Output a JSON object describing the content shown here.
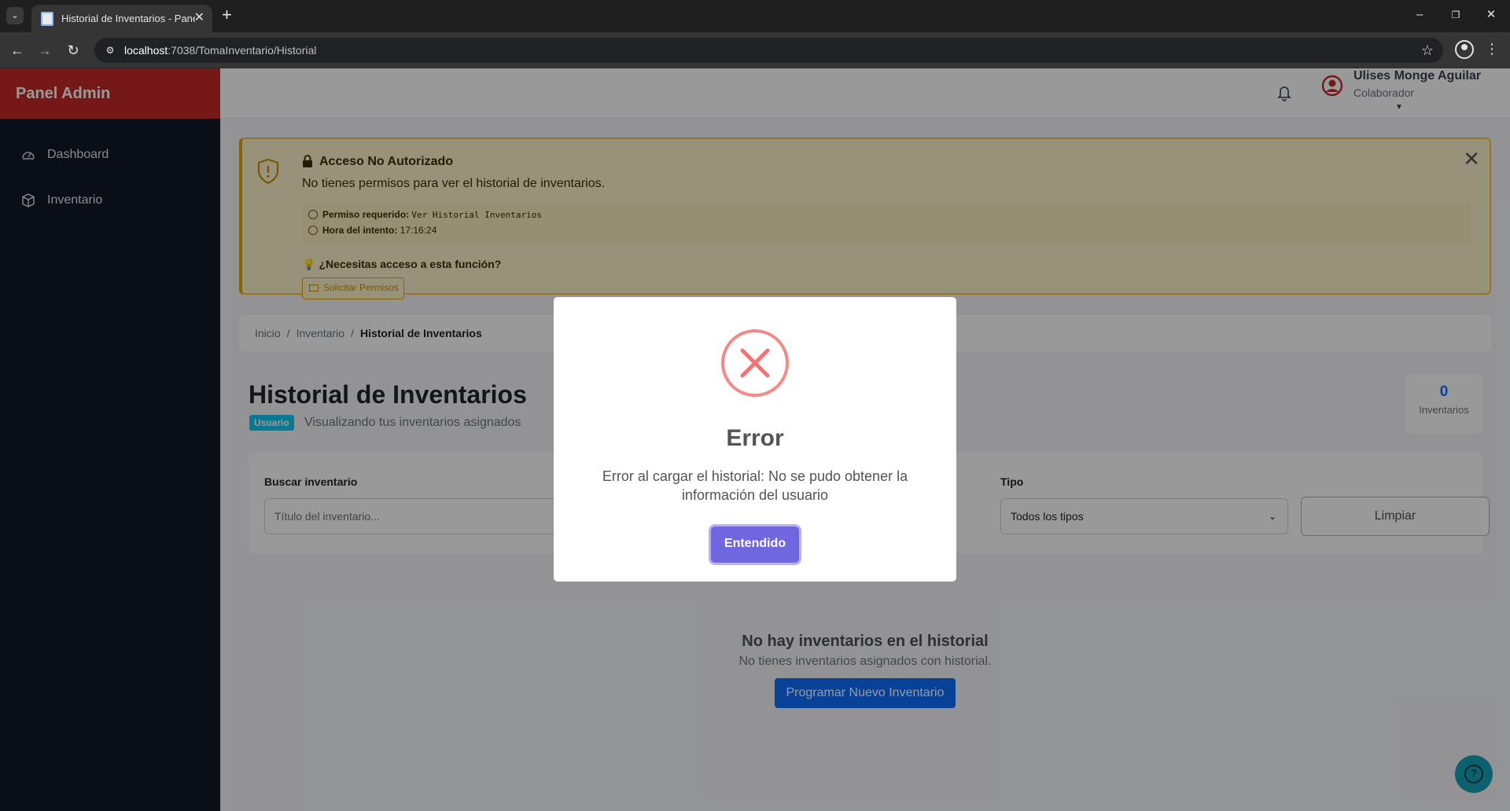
{
  "browser": {
    "tab_title": "Historial de Inventarios - Panel Admin",
    "url_host": "localhost",
    "url_rest": ":7038/TomaInventario/Historial"
  },
  "sidebar": {
    "brand": "Panel Admin",
    "items": [
      {
        "label": "Dashboard",
        "icon": "gauge-icon"
      },
      {
        "label": "Inventario",
        "icon": "box-icon"
      }
    ]
  },
  "topbar": {
    "user_name": "Ulises Monge Aguilar",
    "user_role": "Colaborador"
  },
  "alert": {
    "title": "Acceso No Autorizado",
    "message": "No tienes permisos para ver el historial de inventarios.",
    "permission_label": "Permiso requerido:",
    "permission_value": "Ver Historial Inventarios",
    "time_label": "Hora del intento:",
    "time_value": "17:16:24",
    "help_text": "¿Necesitas acceso a esta función?",
    "request_button": "Solicitar Permisos"
  },
  "breadcrumb": [
    "Inicio",
    "Inventario",
    "Historial de Inventarios"
  ],
  "page": {
    "title": "Historial de Inventarios",
    "badge": "Usuario",
    "subtitle": "Visualizando tus inventarios asignados",
    "count": "0",
    "count_label": "Inventarios"
  },
  "filters": {
    "search_label": "Buscar inventario",
    "search_placeholder": "Título del inventario...",
    "type_label": "Tipo",
    "type_selected": "Todos los tipos",
    "clear_button": "Limpiar"
  },
  "empty": {
    "title": "No hay inventarios en el historial",
    "subtitle": "No tienes inventarios asignados con historial.",
    "button": "Programar Nuevo Inventario"
  },
  "modal": {
    "title": "Error",
    "text": "Error al cargar el historial: No se pudo obtener la información del usuario",
    "button": "Entendido"
  },
  "colors": {
    "brand_red": "#c62828",
    "sidebar_bg": "#111827",
    "warning_border": "#f5c542",
    "primary": "#0d6efd",
    "modal_confirm": "#7066e0",
    "error_icon": "#f27474"
  }
}
